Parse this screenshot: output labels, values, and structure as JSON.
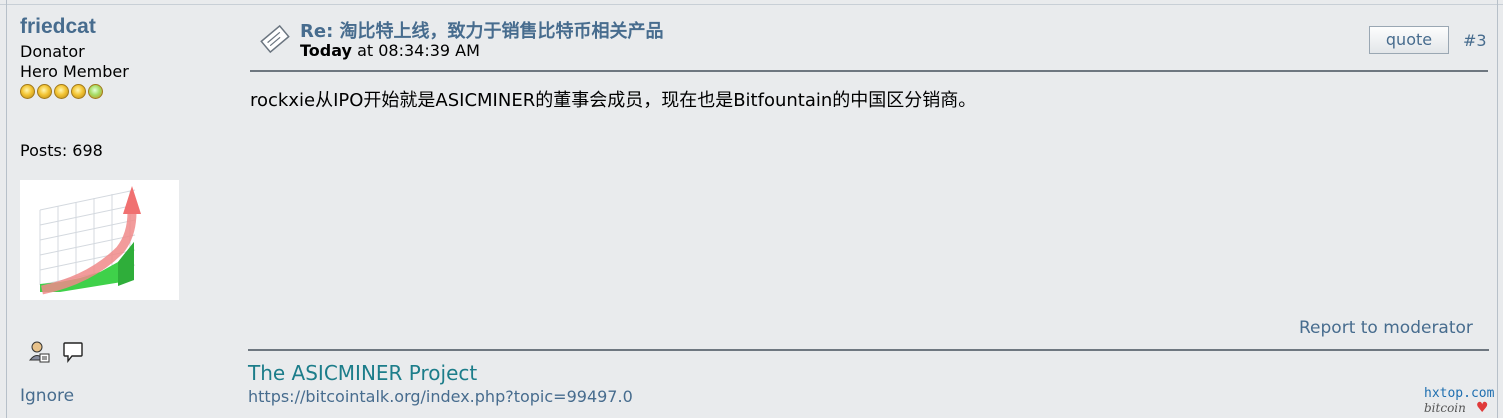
{
  "poster": {
    "name": "friedcat",
    "group": "Donator",
    "rank": "Hero Member",
    "star_count": 5,
    "posts": "Posts: 698",
    "ignore": "Ignore"
  },
  "post": {
    "subject": "Re: 淘比特上线，致力于销售比特币相关产品",
    "date_today": "Today",
    "date_rest": "at 08:34:39 AM",
    "quote_label": "quote",
    "number": "#3",
    "body": "rockxie从IPO开始就是ASICMINER的董事会成员，现在也是Bitfountain的中国区分销商。",
    "report_label": "Report to moderator"
  },
  "signature": {
    "title": "The ASICMINER Project",
    "link": "https://bitcointalk.org/index.php?topic=99497.0"
  },
  "watermark": {
    "site": "hxtop.com",
    "sub": "bitcoin"
  },
  "icons": {
    "subject": "message-icon",
    "profile": "profile-icon",
    "pm": "speech-bubble-icon",
    "avatar": "growth-chart-arrow"
  },
  "colors": {
    "link": "#476c8e",
    "signature": "#1c7d8a",
    "background": "#e9ebed"
  }
}
